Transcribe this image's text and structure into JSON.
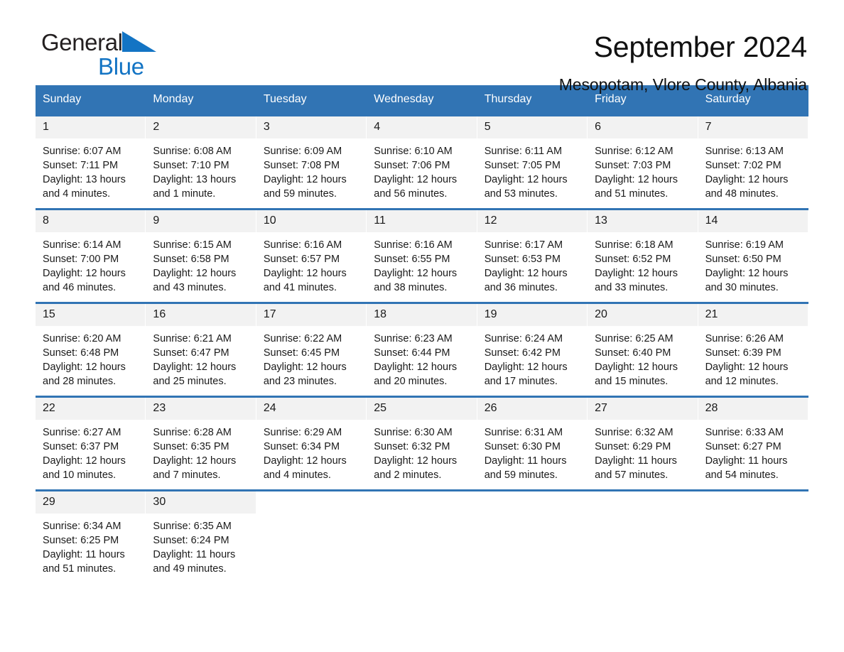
{
  "brand": {
    "name_part1": "General",
    "name_part2": "Blue",
    "triangle_color": "#1374c4"
  },
  "header": {
    "title": "September 2024",
    "subtitle": "Mesopotam, Vlore County, Albania"
  },
  "theme": {
    "header_blue": "#3174b4",
    "daynum_gray": "#f2f2f2",
    "text": "#1a1a1a",
    "brand_blue": "#1374c4"
  },
  "calendar": {
    "weekdays": [
      "Sunday",
      "Monday",
      "Tuesday",
      "Wednesday",
      "Thursday",
      "Friday",
      "Saturday"
    ],
    "weeks": [
      [
        {
          "day": "1",
          "sunrise": "Sunrise: 6:07 AM",
          "sunset": "Sunset: 7:11 PM",
          "daylight_line1": "Daylight: 13 hours",
          "daylight_line2": "and 4 minutes."
        },
        {
          "day": "2",
          "sunrise": "Sunrise: 6:08 AM",
          "sunset": "Sunset: 7:10 PM",
          "daylight_line1": "Daylight: 13 hours",
          "daylight_line2": "and 1 minute."
        },
        {
          "day": "3",
          "sunrise": "Sunrise: 6:09 AM",
          "sunset": "Sunset: 7:08 PM",
          "daylight_line1": "Daylight: 12 hours",
          "daylight_line2": "and 59 minutes."
        },
        {
          "day": "4",
          "sunrise": "Sunrise: 6:10 AM",
          "sunset": "Sunset: 7:06 PM",
          "daylight_line1": "Daylight: 12 hours",
          "daylight_line2": "and 56 minutes."
        },
        {
          "day": "5",
          "sunrise": "Sunrise: 6:11 AM",
          "sunset": "Sunset: 7:05 PM",
          "daylight_line1": "Daylight: 12 hours",
          "daylight_line2": "and 53 minutes."
        },
        {
          "day": "6",
          "sunrise": "Sunrise: 6:12 AM",
          "sunset": "Sunset: 7:03 PM",
          "daylight_line1": "Daylight: 12 hours",
          "daylight_line2": "and 51 minutes."
        },
        {
          "day": "7",
          "sunrise": "Sunrise: 6:13 AM",
          "sunset": "Sunset: 7:02 PM",
          "daylight_line1": "Daylight: 12 hours",
          "daylight_line2": "and 48 minutes."
        }
      ],
      [
        {
          "day": "8",
          "sunrise": "Sunrise: 6:14 AM",
          "sunset": "Sunset: 7:00 PM",
          "daylight_line1": "Daylight: 12 hours",
          "daylight_line2": "and 46 minutes."
        },
        {
          "day": "9",
          "sunrise": "Sunrise: 6:15 AM",
          "sunset": "Sunset: 6:58 PM",
          "daylight_line1": "Daylight: 12 hours",
          "daylight_line2": "and 43 minutes."
        },
        {
          "day": "10",
          "sunrise": "Sunrise: 6:16 AM",
          "sunset": "Sunset: 6:57 PM",
          "daylight_line1": "Daylight: 12 hours",
          "daylight_line2": "and 41 minutes."
        },
        {
          "day": "11",
          "sunrise": "Sunrise: 6:16 AM",
          "sunset": "Sunset: 6:55 PM",
          "daylight_line1": "Daylight: 12 hours",
          "daylight_line2": "and 38 minutes."
        },
        {
          "day": "12",
          "sunrise": "Sunrise: 6:17 AM",
          "sunset": "Sunset: 6:53 PM",
          "daylight_line1": "Daylight: 12 hours",
          "daylight_line2": "and 36 minutes."
        },
        {
          "day": "13",
          "sunrise": "Sunrise: 6:18 AM",
          "sunset": "Sunset: 6:52 PM",
          "daylight_line1": "Daylight: 12 hours",
          "daylight_line2": "and 33 minutes."
        },
        {
          "day": "14",
          "sunrise": "Sunrise: 6:19 AM",
          "sunset": "Sunset: 6:50 PM",
          "daylight_line1": "Daylight: 12 hours",
          "daylight_line2": "and 30 minutes."
        }
      ],
      [
        {
          "day": "15",
          "sunrise": "Sunrise: 6:20 AM",
          "sunset": "Sunset: 6:48 PM",
          "daylight_line1": "Daylight: 12 hours",
          "daylight_line2": "and 28 minutes."
        },
        {
          "day": "16",
          "sunrise": "Sunrise: 6:21 AM",
          "sunset": "Sunset: 6:47 PM",
          "daylight_line1": "Daylight: 12 hours",
          "daylight_line2": "and 25 minutes."
        },
        {
          "day": "17",
          "sunrise": "Sunrise: 6:22 AM",
          "sunset": "Sunset: 6:45 PM",
          "daylight_line1": "Daylight: 12 hours",
          "daylight_line2": "and 23 minutes."
        },
        {
          "day": "18",
          "sunrise": "Sunrise: 6:23 AM",
          "sunset": "Sunset: 6:44 PM",
          "daylight_line1": "Daylight: 12 hours",
          "daylight_line2": "and 20 minutes."
        },
        {
          "day": "19",
          "sunrise": "Sunrise: 6:24 AM",
          "sunset": "Sunset: 6:42 PM",
          "daylight_line1": "Daylight: 12 hours",
          "daylight_line2": "and 17 minutes."
        },
        {
          "day": "20",
          "sunrise": "Sunrise: 6:25 AM",
          "sunset": "Sunset: 6:40 PM",
          "daylight_line1": "Daylight: 12 hours",
          "daylight_line2": "and 15 minutes."
        },
        {
          "day": "21",
          "sunrise": "Sunrise: 6:26 AM",
          "sunset": "Sunset: 6:39 PM",
          "daylight_line1": "Daylight: 12 hours",
          "daylight_line2": "and 12 minutes."
        }
      ],
      [
        {
          "day": "22",
          "sunrise": "Sunrise: 6:27 AM",
          "sunset": "Sunset: 6:37 PM",
          "daylight_line1": "Daylight: 12 hours",
          "daylight_line2": "and 10 minutes."
        },
        {
          "day": "23",
          "sunrise": "Sunrise: 6:28 AM",
          "sunset": "Sunset: 6:35 PM",
          "daylight_line1": "Daylight: 12 hours",
          "daylight_line2": "and 7 minutes."
        },
        {
          "day": "24",
          "sunrise": "Sunrise: 6:29 AM",
          "sunset": "Sunset: 6:34 PM",
          "daylight_line1": "Daylight: 12 hours",
          "daylight_line2": "and 4 minutes."
        },
        {
          "day": "25",
          "sunrise": "Sunrise: 6:30 AM",
          "sunset": "Sunset: 6:32 PM",
          "daylight_line1": "Daylight: 12 hours",
          "daylight_line2": "and 2 minutes."
        },
        {
          "day": "26",
          "sunrise": "Sunrise: 6:31 AM",
          "sunset": "Sunset: 6:30 PM",
          "daylight_line1": "Daylight: 11 hours",
          "daylight_line2": "and 59 minutes."
        },
        {
          "day": "27",
          "sunrise": "Sunrise: 6:32 AM",
          "sunset": "Sunset: 6:29 PM",
          "daylight_line1": "Daylight: 11 hours",
          "daylight_line2": "and 57 minutes."
        },
        {
          "day": "28",
          "sunrise": "Sunrise: 6:33 AM",
          "sunset": "Sunset: 6:27 PM",
          "daylight_line1": "Daylight: 11 hours",
          "daylight_line2": "and 54 minutes."
        }
      ],
      [
        {
          "day": "29",
          "sunrise": "Sunrise: 6:34 AM",
          "sunset": "Sunset: 6:25 PM",
          "daylight_line1": "Daylight: 11 hours",
          "daylight_line2": "and 51 minutes."
        },
        {
          "day": "30",
          "sunrise": "Sunrise: 6:35 AM",
          "sunset": "Sunset: 6:24 PM",
          "daylight_line1": "Daylight: 11 hours",
          "daylight_line2": "and 49 minutes."
        },
        {
          "day": "",
          "sunrise": "",
          "sunset": "",
          "daylight_line1": "",
          "daylight_line2": ""
        },
        {
          "day": "",
          "sunrise": "",
          "sunset": "",
          "daylight_line1": "",
          "daylight_line2": ""
        },
        {
          "day": "",
          "sunrise": "",
          "sunset": "",
          "daylight_line1": "",
          "daylight_line2": ""
        },
        {
          "day": "",
          "sunrise": "",
          "sunset": "",
          "daylight_line1": "",
          "daylight_line2": ""
        },
        {
          "day": "",
          "sunrise": "",
          "sunset": "",
          "daylight_line1": "",
          "daylight_line2": ""
        }
      ]
    ]
  }
}
